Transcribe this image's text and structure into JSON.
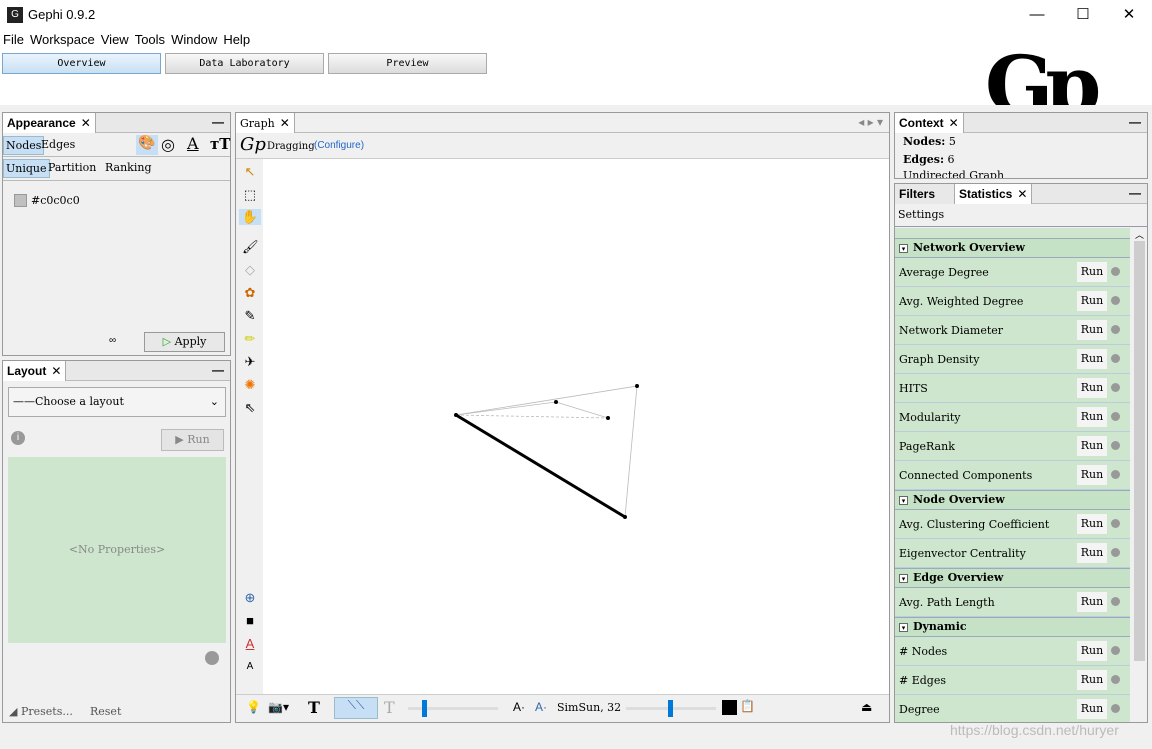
{
  "window": {
    "title": "Gephi 0.9.2",
    "minimize": "—",
    "maximize": "☐",
    "close": "✕"
  },
  "menu": [
    "File",
    "Workspace",
    "View",
    "Tools",
    "Window",
    "Help"
  ],
  "modes": [
    "Overview",
    "Data Laboratory",
    "Preview"
  ],
  "appearance": {
    "tab": "Appearance",
    "close": "✕",
    "target_tabs": [
      "Nodes",
      "Edges"
    ],
    "mode_tabs": [
      "Unique",
      "Partition",
      "Ranking"
    ],
    "color_label": "#c0c0c0",
    "color": "#c0c0c0",
    "apply": "Apply"
  },
  "layout": {
    "tab": "Layout",
    "close": "✕",
    "select": "——Choose a layout",
    "run": "Run",
    "no_properties": "<No Properties>",
    "presets": "Presets...",
    "reset": "Reset"
  },
  "graph": {
    "tab": "Graph",
    "close": "✕",
    "tool": "Dragging",
    "configure": "(Configure)",
    "font": "SimSun, 32"
  },
  "context": {
    "tab": "Context",
    "close": "✕",
    "nodes_label": "Nodes:",
    "nodes": "5",
    "edges_label": "Edges:",
    "edges": "6",
    "type": "Undirected Graph"
  },
  "stats": {
    "tabs": [
      "Filters",
      "Statistics"
    ],
    "close": "✕",
    "settings": "Settings",
    "run": "Run",
    "sections": [
      {
        "title": "Network Overview",
        "items": [
          "Average Degree",
          "Avg. Weighted Degree",
          "Network Diameter",
          "Graph Density",
          "HITS",
          "Modularity",
          "PageRank",
          "Connected Components"
        ]
      },
      {
        "title": "Node Overview",
        "items": [
          "Avg. Clustering Coefficient",
          "Eigenvector Centrality"
        ]
      },
      {
        "title": "Edge Overview",
        "items": [
          "Avg. Path Length"
        ]
      },
      {
        "title": "Dynamic",
        "items": [
          "# Nodes",
          "# Edges",
          "Degree"
        ]
      }
    ]
  },
  "watermark": "https://blog.csdn.net/huryer"
}
